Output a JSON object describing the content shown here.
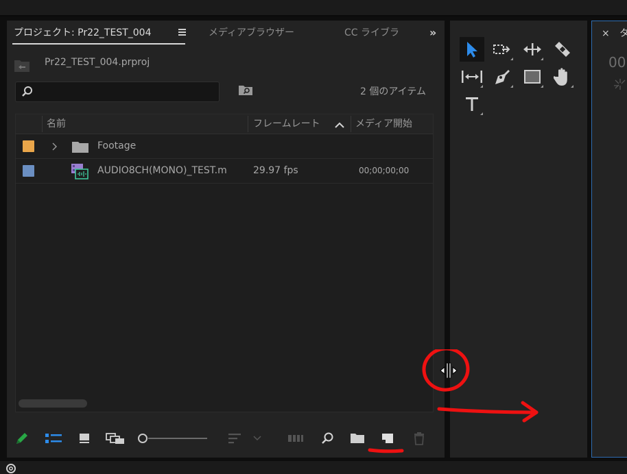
{
  "tabs": {
    "project": "プロジェクト: Pr22_TEST_004",
    "media_browser": "メディアブラウザー",
    "cc_libraries": "CC ライブラ",
    "more": "»"
  },
  "project": {
    "file_name": "Pr22_TEST_004.prproj",
    "search_value": "",
    "item_count": "2 個のアイテム"
  },
  "table": {
    "columns": [
      "名前",
      "フレームレート",
      "メディア開始"
    ],
    "rows": [
      {
        "swatch": "#eaa64a",
        "name": "Footage",
        "frame_rate": "",
        "media_start": ""
      },
      {
        "swatch": "#6b8fc2",
        "name": "AUDIO8CH(MONO)_TEST.m",
        "frame_rate": "29.97 fps",
        "media_start": "00;00;00;00"
      }
    ]
  },
  "right_panel": {
    "close": "×",
    "tab": "タ",
    "timecode": "00"
  },
  "colors": {
    "accent_blue": "#2d8ceb",
    "annotation_red": "#ee1111",
    "green_pencil": "#28a745"
  },
  "icons": [
    "search-icon",
    "find-icon",
    "folder-icon",
    "clip-icon",
    "pencil-icon",
    "list-view-icon",
    "icon-view-icon",
    "freeform-view-icon",
    "sort-icon",
    "automate-icon",
    "new-bin-icon",
    "new-item-icon",
    "trash-icon",
    "selection-tool-icon",
    "track-select-icon",
    "ripple-edit-icon",
    "razor-icon",
    "slip-icon",
    "pen-icon",
    "rectangle-icon",
    "hand-icon",
    "type-icon",
    "resize-cursor-icon"
  ]
}
